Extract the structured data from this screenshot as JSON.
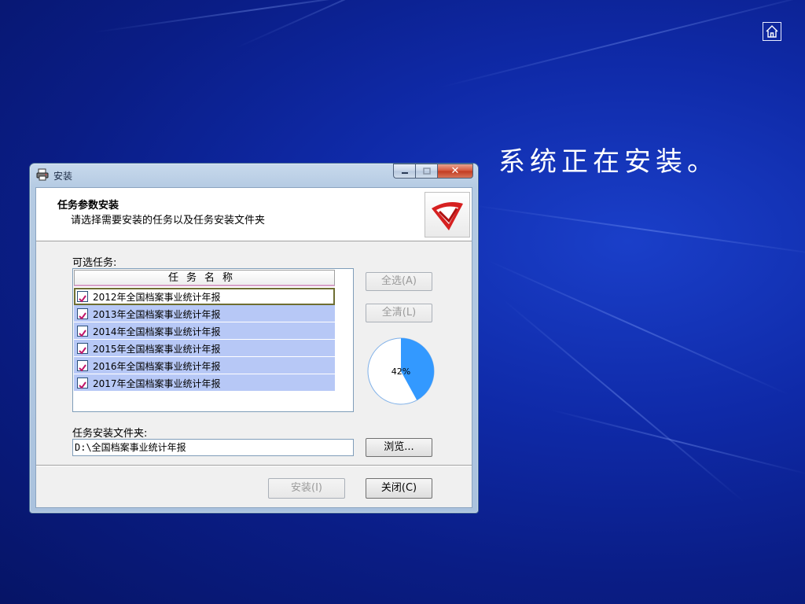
{
  "slide": {
    "text": "系统正在安装。",
    "home_icon": "home-icon"
  },
  "window": {
    "title": "安装",
    "app_icon": "printer-icon"
  },
  "header": {
    "title": "任务参数安装",
    "subtitle": "请选择需要安装的任务以及任务安装文件夹"
  },
  "tasks": {
    "label": "可选任务:",
    "column_header": "任务名称",
    "items": [
      {
        "label": "2012年全国档案事业统计年报",
        "checked": true
      },
      {
        "label": "2013年全国档案事业统计年报",
        "checked": true
      },
      {
        "label": "2014年全国档案事业统计年报",
        "checked": true
      },
      {
        "label": "2015年全国档案事业统计年报",
        "checked": true
      },
      {
        "label": "2016年全国档案事业统计年报",
        "checked": true
      },
      {
        "label": "2017年全国档案事业统计年报",
        "checked": true
      }
    ]
  },
  "buttons": {
    "select_all": "全选(A)",
    "clear_all": "全清(L)",
    "browse": "浏览...",
    "install": "安装(I)",
    "close": "关闭(C)"
  },
  "progress": {
    "label": "42%",
    "percent": 42,
    "color": "#3399ff"
  },
  "folder": {
    "label": "任务安装文件夹:",
    "path": "D:\\全国档案事业统计年报"
  }
}
